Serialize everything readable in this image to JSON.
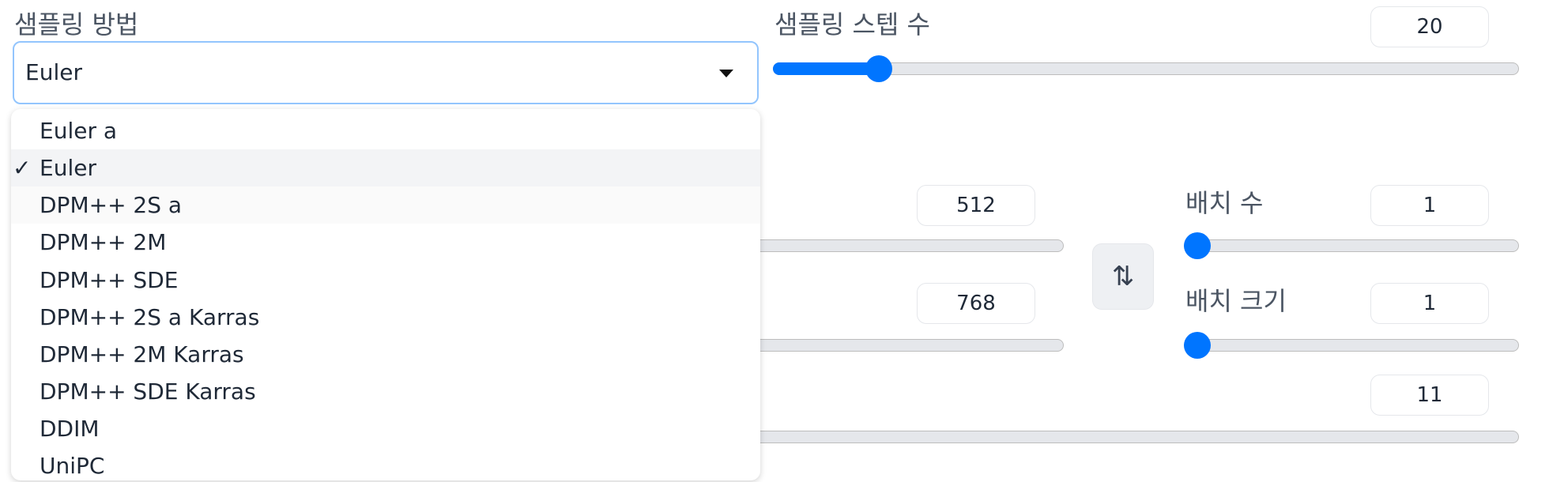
{
  "sampler": {
    "label": "샘플링 방법",
    "selected": "Euler",
    "check_mark": "✓",
    "options": [
      "Euler a",
      "Euler",
      "DPM++ 2S a",
      "DPM++ 2M",
      "DPM++ SDE",
      "DPM++ 2S a Karras",
      "DPM++ 2M Karras",
      "DPM++ SDE Karras",
      "DDIM",
      "UniPC"
    ]
  },
  "steps": {
    "label": "샘플링 스텝 수",
    "value": "20"
  },
  "width": {
    "value": "512"
  },
  "height": {
    "value": "768"
  },
  "batch_count": {
    "label": "배치 수",
    "value": "1"
  },
  "batch_size": {
    "label": "배치 크기",
    "value": "1"
  },
  "cfg": {
    "value": "11"
  },
  "swap_icon": "swap-vertical-arrows-icon",
  "colors": {
    "accent": "#0075ff",
    "focus_border": "#93c5fd"
  }
}
